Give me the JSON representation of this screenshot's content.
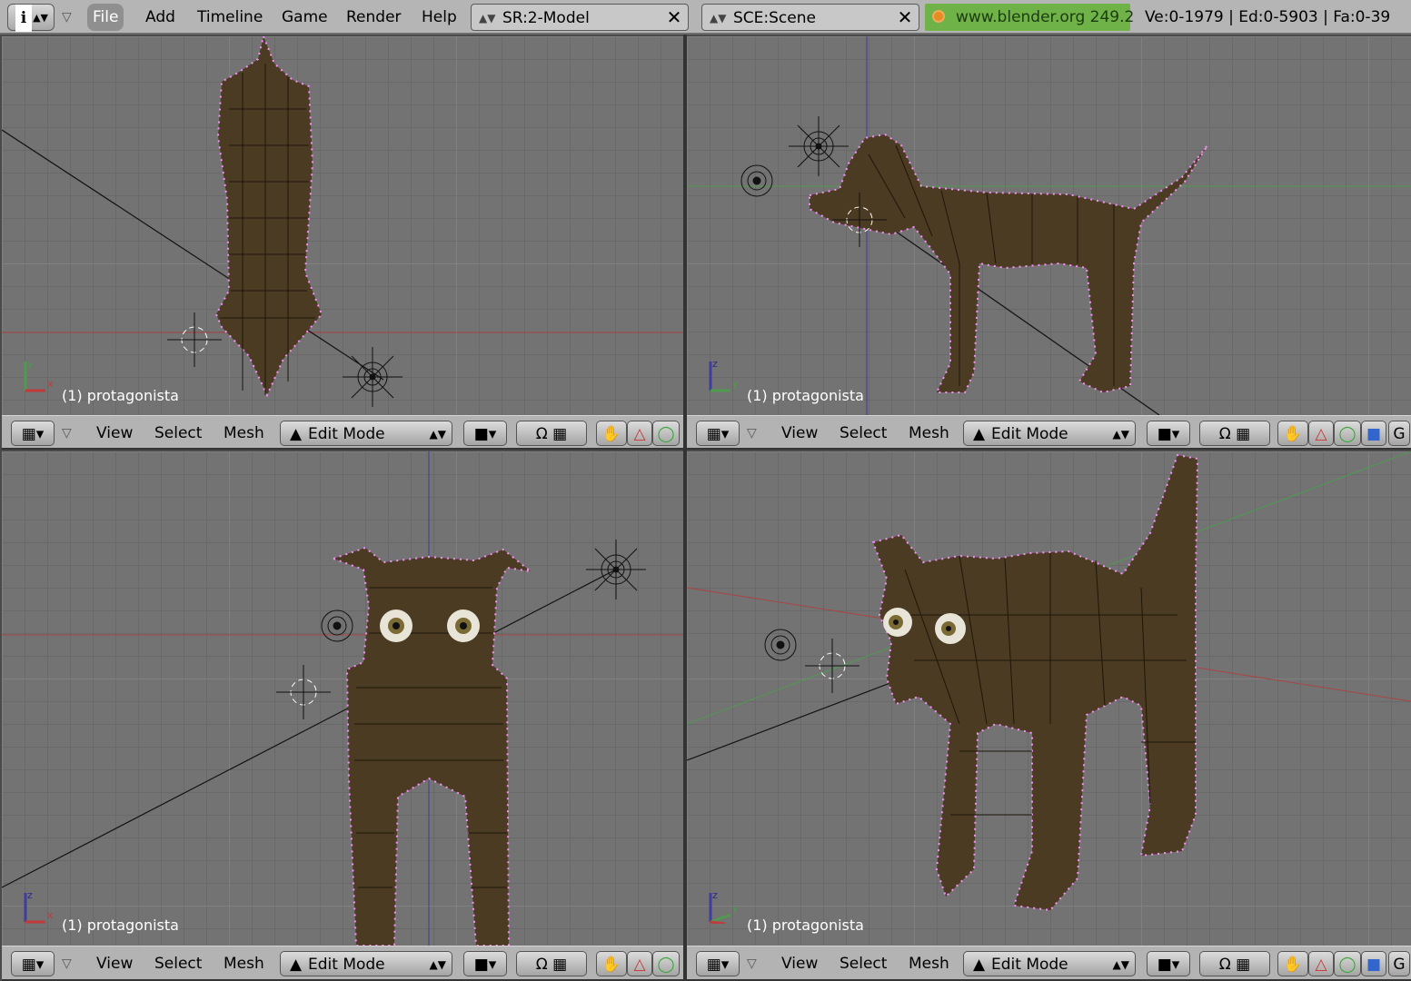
{
  "topbar": {
    "info_icon": "i",
    "menus": [
      "File",
      "Add",
      "Timeline",
      "Game",
      "Render",
      "Help"
    ],
    "screen_field": "SR:2-Model",
    "scene_field": "SCE:Scene",
    "url": "www.blender.org 249.2",
    "stats": "Ve:0-1979 | Ed:0-5903 | Fa:0-39"
  },
  "viewports": {
    "top_left": {
      "object_label": "(1) protagonista",
      "axis_a": "y",
      "axis_b": "x"
    },
    "top_right": {
      "object_label": "(1) protagonista",
      "axis_a": "z",
      "axis_b": "y"
    },
    "bottom_left": {
      "object_label": "(1) protagonista",
      "axis_a": "z",
      "axis_b": "x"
    },
    "bottom_right": {
      "object_label": "(1) protagonista",
      "axis_a": "z",
      "axis_b": "y"
    }
  },
  "header": {
    "view": "View",
    "select": "Select",
    "mesh": "Mesh",
    "mode": "Edit Mode",
    "extra_letter": "G"
  },
  "colors": {
    "mesh_fill": "#4a3b22",
    "mesh_vertices": "#ff8cff",
    "x_axis_line": "#a74545",
    "y_axis_line": "#4f9a4f",
    "z_axis_line": "#3e3e9e"
  }
}
